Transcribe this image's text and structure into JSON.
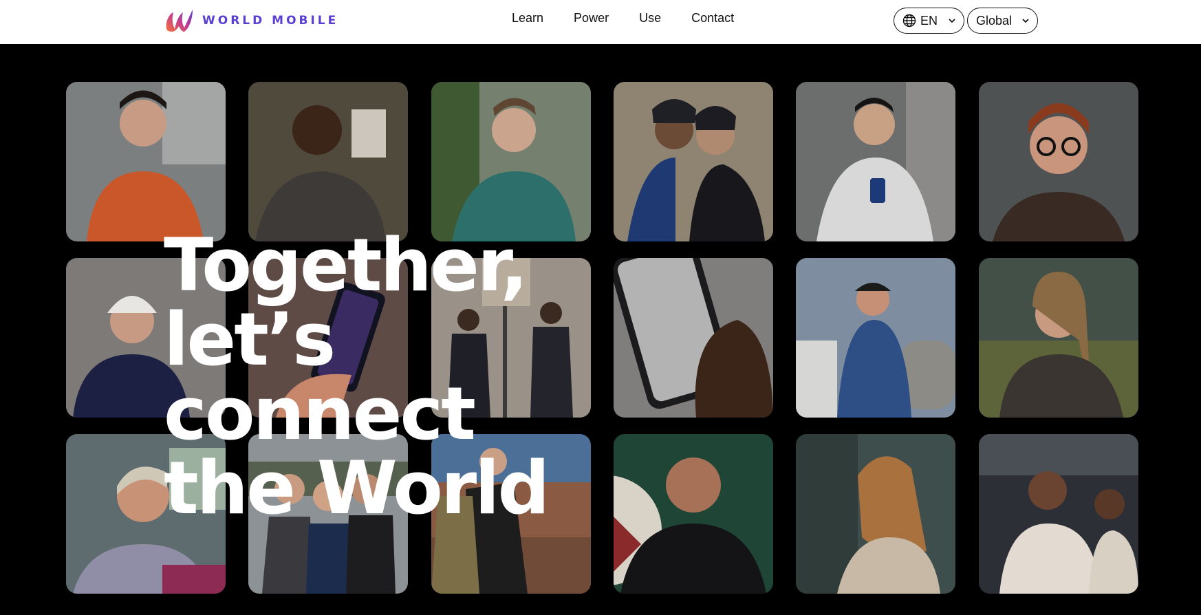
{
  "header": {
    "brand": "WORLD MOBILE",
    "nav": [
      {
        "label": "Learn"
      },
      {
        "label": "Power"
      },
      {
        "label": "Use"
      },
      {
        "label": "Contact"
      }
    ],
    "language": {
      "value": "EN",
      "icon": "globe-icon"
    },
    "region": {
      "value": "Global"
    }
  },
  "hero": {
    "lines": [
      "Together,",
      "let’s connect",
      "the World"
    ]
  },
  "colors": {
    "brand_purple": "#5a3fd1",
    "logo_gradient": [
      "#f2733a",
      "#c53c8e",
      "#5a3fd1"
    ],
    "background": "#000000"
  }
}
